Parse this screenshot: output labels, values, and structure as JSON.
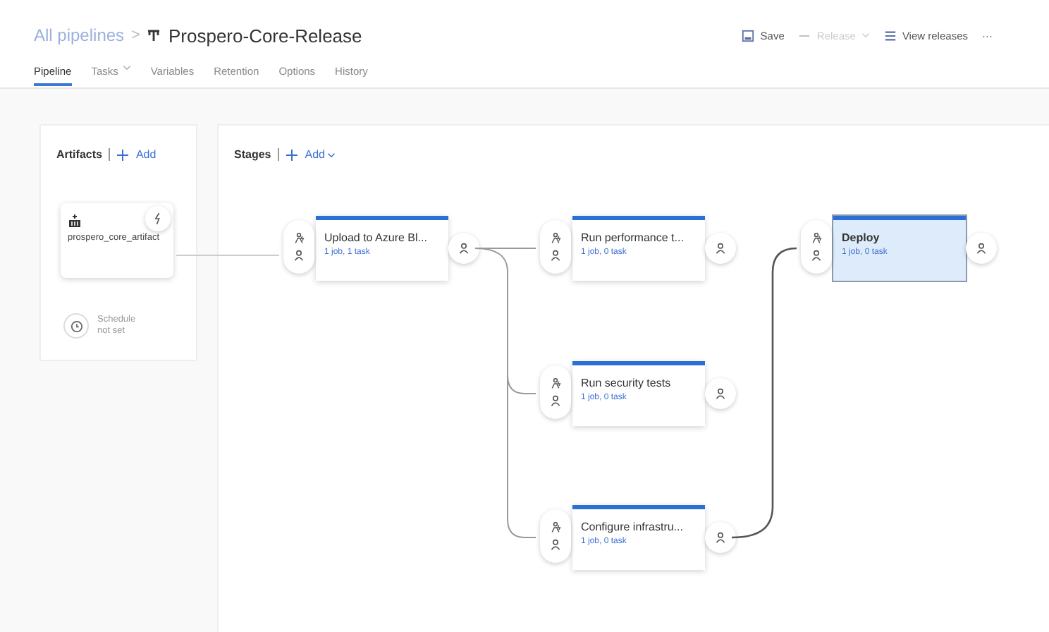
{
  "breadcrumb": {
    "parent": "All pipelines",
    "separator": ">",
    "title": "Prospero-Core-Release"
  },
  "toolbar": [
    {
      "label": "Save",
      "kind": "save",
      "disabled": false
    },
    {
      "label": "Release",
      "kind": "release",
      "disabled": true
    },
    {
      "label": "View releases",
      "kind": "list",
      "disabled": false
    },
    {
      "label": "···",
      "kind": "more",
      "disabled": false
    }
  ],
  "tabs": [
    {
      "label": "Pipeline",
      "selected": true,
      "dropdown": false
    },
    {
      "label": "Tasks",
      "selected": false,
      "dropdown": true
    },
    {
      "label": "Variables",
      "selected": false,
      "dropdown": false
    },
    {
      "label": "Retention",
      "selected": false,
      "dropdown": false
    },
    {
      "label": "Options",
      "selected": false,
      "dropdown": false
    },
    {
      "label": "History",
      "selected": false,
      "dropdown": false
    }
  ],
  "artifacts": {
    "title": "Artifacts",
    "add": "Add",
    "items": [
      {
        "name": "prospero_core_artifact"
      }
    ],
    "schedule": "Schedule not set"
  },
  "stages": {
    "title": "Stages",
    "add": "Add",
    "items": [
      {
        "name": "Upload to Azure Bl...",
        "summary": "1 job, 1 task",
        "selected": false
      },
      {
        "name": "Run performance t...",
        "summary": "1 job, 0 task",
        "selected": false
      },
      {
        "name": "Deploy",
        "summary": "1 job, 0 task",
        "selected": true
      },
      {
        "name": "Run security tests",
        "summary": "1 job, 0 task",
        "selected": false
      },
      {
        "name": "Configure infrastru...",
        "summary": "1 job, 0 task",
        "selected": false
      }
    ]
  }
}
